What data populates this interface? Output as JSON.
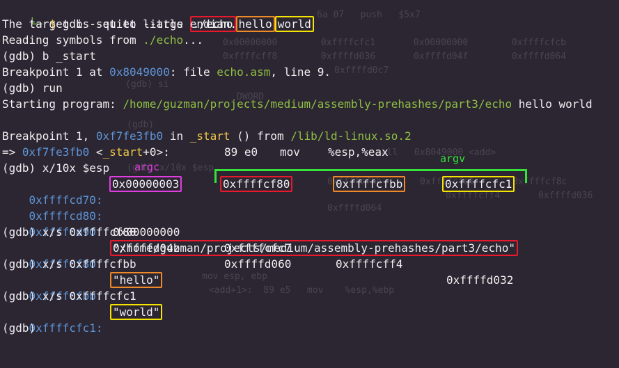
{
  "background_text": {
    "g1": "6a 07   push   $5x7",
    "g2": "0x00000000        0xffffcfc1       0x00000000        0xffffcfcb",
    "g3": "0xffffcff8        0xffffd036       0xffffd04f        0xffffd064",
    "g4": "0xffffd0c7",
    "g5": "(gdb) si",
    "g6": "DWORD",
    "g7": "(gdb)",
    "g8": "call   0x8049000 <add>",
    "g9": "(gdb) x/10x $esp",
    "g10": "0xffffcfbb       0xffffcfc1       0xffffcf8c",
    "g11": "0xffffcff4       0xffffd036",
    "g12": "0xffffd064",
    "g13": "mov esp, ebp",
    "g14": "<add+1>:  89 e5   mov    %esp,%ebp"
  },
  "cmd": {
    "branch": "└─",
    "dollar": "$",
    "text": " gdb --quiet --args ",
    "arg0": "./echo",
    "arg1": "hello",
    "arg2": "world"
  },
  "lines": {
    "endian": "The target is set to little endian.",
    "reading_prefix": "Reading symbols from ",
    "reading_path": "./echo",
    "reading_suffix": "...",
    "b_cmd": "(gdb) b _start",
    "bp_prefix": "Breakpoint 1 at ",
    "bp_addr": "0x8049000",
    "bp_mid": ": file ",
    "bp_file": "echo.asm",
    "bp_suffix": ", line 9.",
    "run_cmd": "(gdb) run",
    "start_prefix": "Starting program: ",
    "start_path": "/home/guzman/projects/medium/assembly-prehashes/part3/echo",
    "start_args": " hello world",
    "hit_prefix": "Breakpoint 1, ",
    "hit_addr": "0xf7fe3fb0",
    "hit_in": " in ",
    "hit_func": "_start",
    "hit_mid": " () from ",
    "hit_lib": "/lib/ld-linux.so.2",
    "arrow": "=> ",
    "arrow_addr": "0xf7fe3fb0",
    "arrow_lt": " <",
    "arrow_func": "_start",
    "arrow_off": "+0>:",
    "arrow_bytes": "89 e0",
    "arrow_op": "mov",
    "arrow_args": "%esp,%eax",
    "x10_cmd": "(gdb) x/10x $esp",
    "xs1_cmd": "(gdb) x/s 0xffffcf80",
    "xs2_cmd": "(gdb) x/s 0xffffcfbb",
    "xs3_cmd": "(gdb) x/s 0xffffcfc1",
    "last": "(gdb)"
  },
  "memory": {
    "rows": [
      {
        "addr": "0xffffcd70:",
        "v": [
          "0x00000003",
          "0xffffcf80",
          "0xffffcfbb",
          "0xffffcfc1"
        ]
      },
      {
        "addr": "0xffffcd80:",
        "v": [
          "0x00000000",
          "0xffffcfc7",
          "0xffffcff4",
          "0xffffd032"
        ]
      },
      {
        "addr": "0xffffcd90:",
        "v": [
          "0xffffd04b",
          "0xffffd060"
        ]
      }
    ]
  },
  "strings": {
    "s1_addr": "0xffffcf80:",
    "s1_val": "\"/home/guzman/projects/medium/assembly-prehashes/part3/echo\"",
    "s2_addr": "0xffffcfbb:",
    "s2_val": "\"hello\"",
    "s3_addr": "0xffffcfc1:",
    "s3_val": "\"world\""
  },
  "annotations": {
    "argc": "argc",
    "argv": "argv"
  },
  "colors": {
    "red": "#e8192c",
    "orange": "#f08a24",
    "yellow": "#f5e400",
    "magenta": "#e03ee0",
    "green": "#36e23a"
  }
}
